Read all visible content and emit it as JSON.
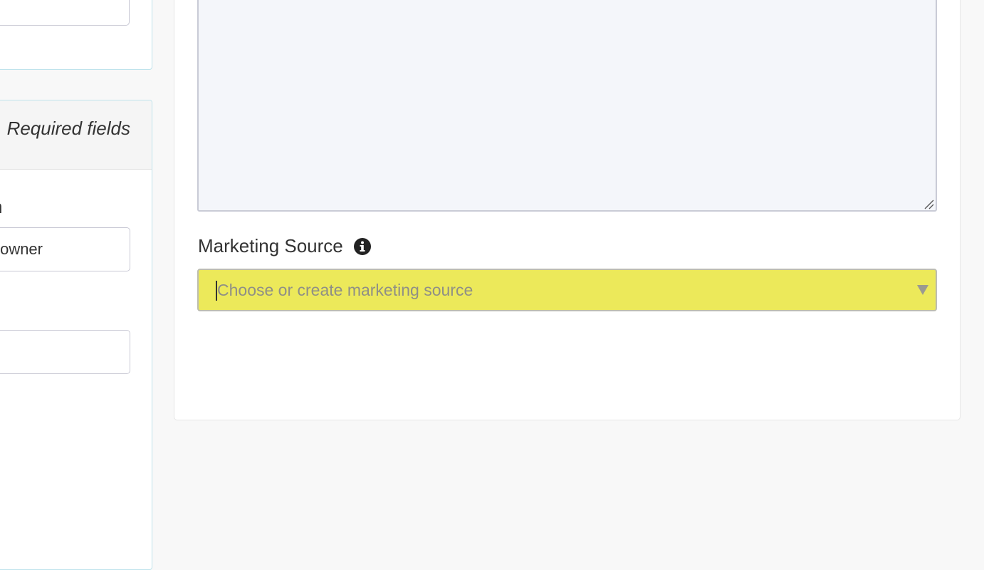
{
  "left_panel": {
    "required_fields_note": "Required fields",
    "field_label_fragment": "n",
    "field_value_fragment": "owner",
    "second_field_value": ""
  },
  "main": {
    "marketing_source": {
      "label": "Marketing Source",
      "info_icon": "info-circle-icon",
      "placeholder": "Choose or create marketing source",
      "highlight_color": "#ece95a"
    }
  }
}
